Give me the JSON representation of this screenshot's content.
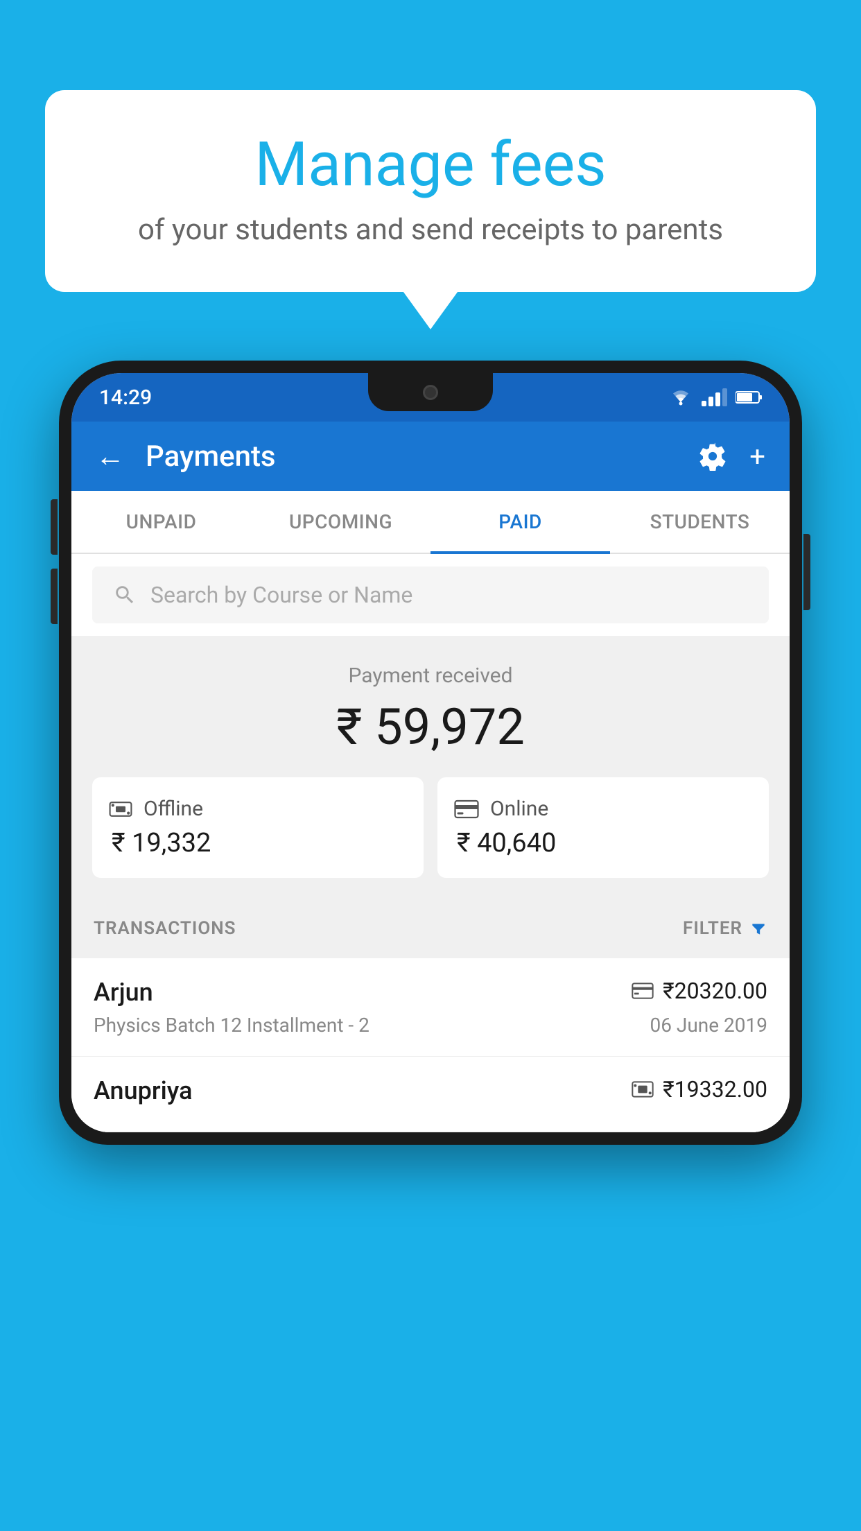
{
  "background_color": "#1ab0e8",
  "bubble": {
    "title": "Manage fees",
    "subtitle": "of your students and send receipts to parents"
  },
  "status_bar": {
    "time": "14:29",
    "wifi": "▾",
    "battery": "▮"
  },
  "app_bar": {
    "title": "Payments",
    "back_label": "←",
    "settings_label": "⚙",
    "add_label": "+"
  },
  "tabs": [
    {
      "label": "UNPAID",
      "active": false
    },
    {
      "label": "UPCOMING",
      "active": false
    },
    {
      "label": "PAID",
      "active": true
    },
    {
      "label": "STUDENTS",
      "active": false
    }
  ],
  "search": {
    "placeholder": "Search by Course or Name"
  },
  "payment_summary": {
    "label": "Payment received",
    "total": "₹ 59,972",
    "offline": {
      "label": "Offline",
      "amount": "₹ 19,332"
    },
    "online": {
      "label": "Online",
      "amount": "₹ 40,640"
    }
  },
  "transactions": {
    "header_label": "TRANSACTIONS",
    "filter_label": "FILTER",
    "items": [
      {
        "name": "Arjun",
        "course": "Physics Batch 12 Installment - 2",
        "amount": "₹20320.00",
        "date": "06 June 2019",
        "payment_type": "card"
      },
      {
        "name": "Anupriya",
        "course": "",
        "amount": "₹19332.00",
        "date": "",
        "payment_type": "cash"
      }
    ]
  }
}
